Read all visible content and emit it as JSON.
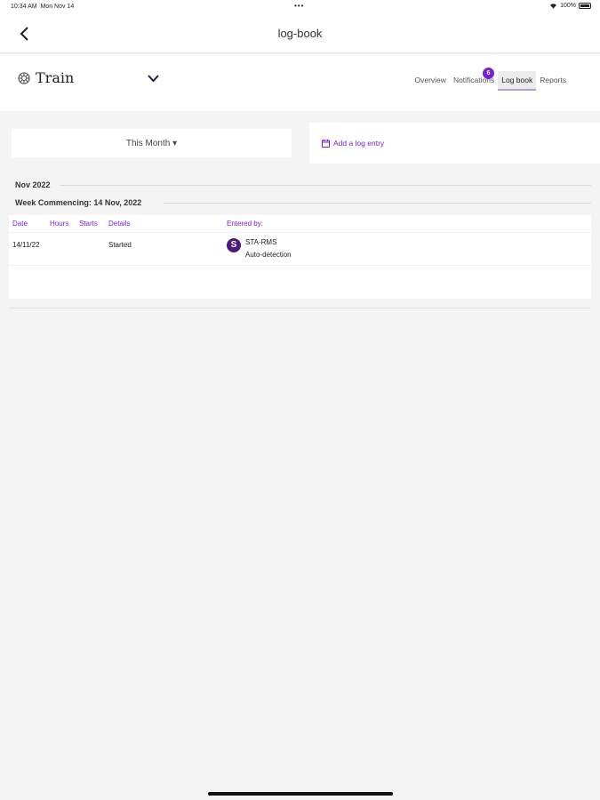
{
  "status": {
    "time": "10:34 AM",
    "date": "Mon Nov 14",
    "dots": "•••",
    "battery": "100%"
  },
  "nav": {
    "title": "log-book",
    "back_icon": "chevron-left-icon"
  },
  "asset": {
    "name": "Train",
    "icon": "gear-icon",
    "dropdown_icon": "chevron-down-icon"
  },
  "tabs": [
    {
      "label": "Overview"
    },
    {
      "label": "Notifications"
    },
    {
      "label": "Log book"
    },
    {
      "label": "Reports"
    }
  ],
  "notifications_badge": "6",
  "filter": {
    "label": "This Month ▾"
  },
  "add_entry": {
    "label": "Add a log entry",
    "icon": "calendar-icon"
  },
  "month_heading": "Nov 2022",
  "week_heading": "Week Commencing: 14 Nov, 2022",
  "table": {
    "headers": {
      "date": "Date",
      "hours": "Hours",
      "starts": "Starts",
      "details": "Details",
      "entered_by": "Entered by:"
    },
    "rows": [
      {
        "date": "14/11/22",
        "hours": "",
        "starts": "",
        "details": "Started",
        "avatar": "S",
        "entered_by": "STA-RMS",
        "source": "Auto-detection"
      }
    ]
  },
  "colors": {
    "accent": "#7a1fd6",
    "avatar": "#4b1a7a"
  }
}
